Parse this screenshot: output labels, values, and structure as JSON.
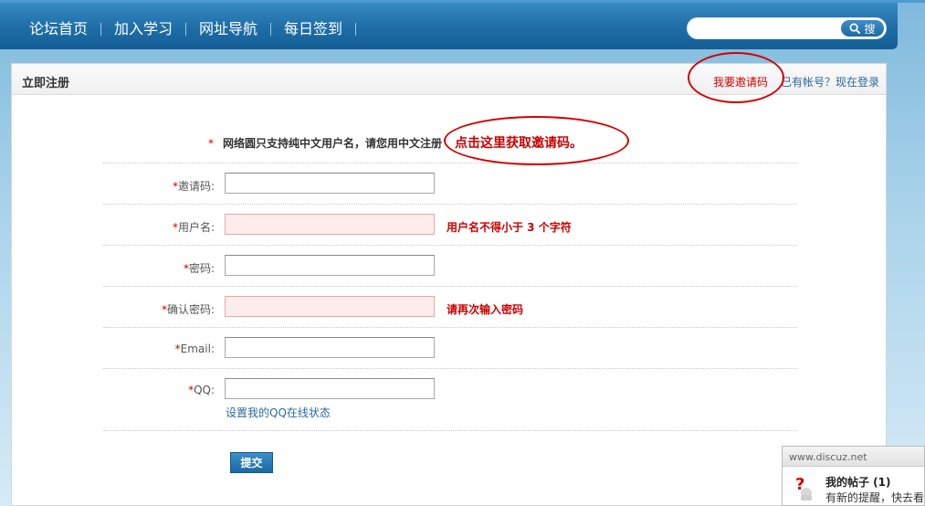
{
  "nav": {
    "items": [
      "论坛首页",
      "加入学习",
      "网址导航",
      "每日签到"
    ]
  },
  "search": {
    "placeholder": "",
    "button_label": "搜"
  },
  "panel": {
    "title": "立即注册",
    "invite_link": "我要邀请码",
    "login_link": "已有帐号？现在登录"
  },
  "form": {
    "notice_star": "*",
    "notice": "网络圆只支持纯中文用户名，请您用中文注册",
    "callout": "点击这里获取邀请码。",
    "fields": [
      {
        "label": "邀请码:",
        "value": ""
      },
      {
        "label": "用户名:",
        "value": "",
        "tip": "用户名不得小于 3 个字符"
      },
      {
        "label": "密码:",
        "value": ""
      },
      {
        "label": "确认密码:",
        "value": "",
        "tip": "请再次输入密码"
      },
      {
        "label": "Email:",
        "value": ""
      },
      {
        "label": "QQ:",
        "value": ""
      }
    ],
    "qq_link": "设置我的QQ在线状态",
    "submit_label": "提交"
  },
  "popup": {
    "site": "www.discuz.net",
    "title": "我的帖子 (1)",
    "text": "有新的提醒，快去看看"
  },
  "colors": {
    "nav_bg": "#1f6ea8",
    "error": "#cc0000",
    "link": "#2b6a9e"
  }
}
